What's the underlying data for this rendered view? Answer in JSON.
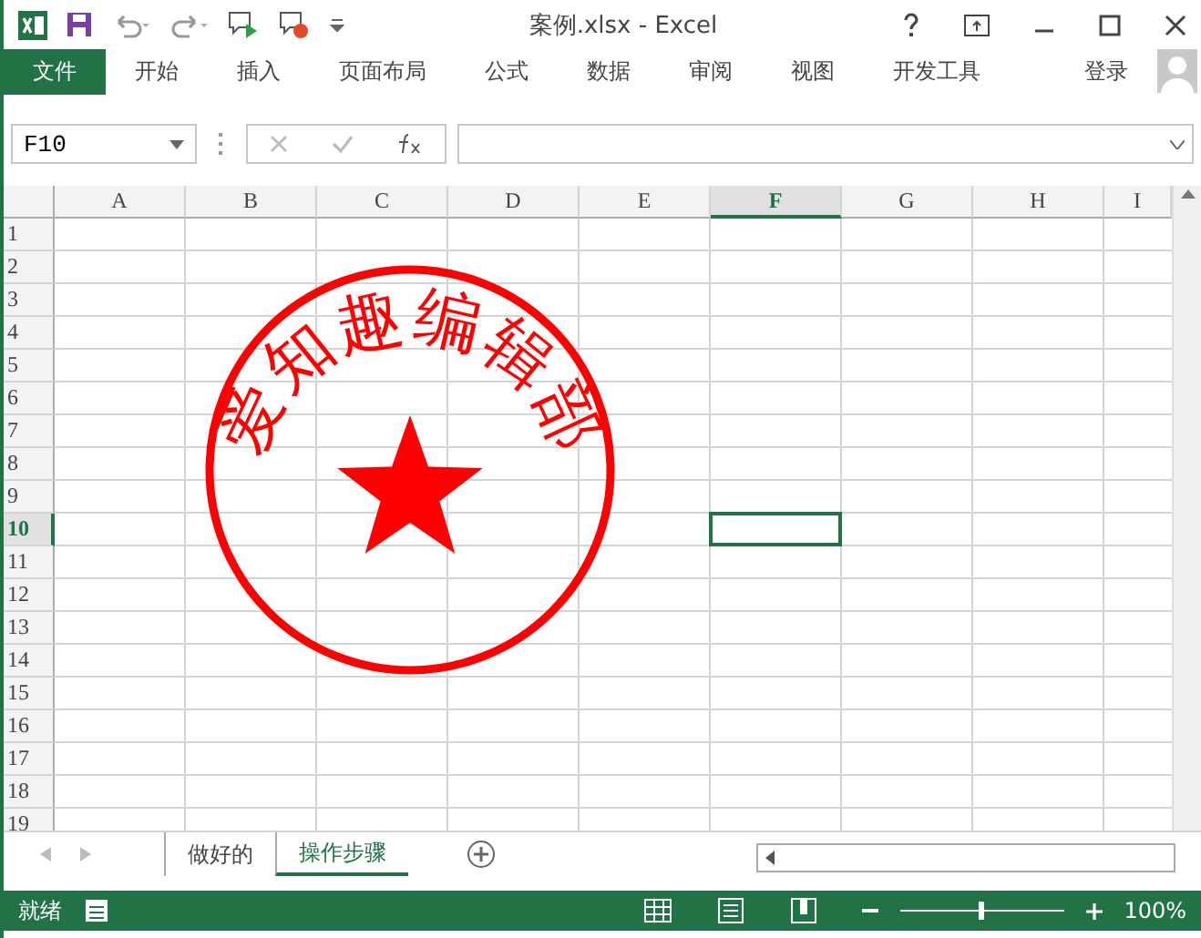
{
  "window": {
    "title": "案例.xlsx - Excel"
  },
  "ribbon_tabs": [
    {
      "label": "文件",
      "selected": true
    },
    {
      "label": "开始",
      "selected": false
    },
    {
      "label": "插入",
      "selected": false
    },
    {
      "label": "页面布局",
      "selected": false
    },
    {
      "label": "公式",
      "selected": false
    },
    {
      "label": "数据",
      "selected": false
    },
    {
      "label": "审阅",
      "selected": false
    },
    {
      "label": "视图",
      "selected": false
    },
    {
      "label": "开发工具",
      "selected": false
    }
  ],
  "sign_in": "登录",
  "name_box": "F10",
  "columns": [
    {
      "label": "A",
      "selected": false
    },
    {
      "label": "B",
      "selected": false
    },
    {
      "label": "C",
      "selected": false
    },
    {
      "label": "D",
      "selected": false
    },
    {
      "label": "E",
      "selected": false
    },
    {
      "label": "F",
      "selected": true
    },
    {
      "label": "G",
      "selected": false
    },
    {
      "label": "H",
      "selected": false
    },
    {
      "label": "I",
      "selected": false
    }
  ],
  "rows": [
    {
      "label": "1",
      "selected": false
    },
    {
      "label": "2",
      "selected": false
    },
    {
      "label": "3",
      "selected": false
    },
    {
      "label": "4",
      "selected": false
    },
    {
      "label": "5",
      "selected": false
    },
    {
      "label": "6",
      "selected": false
    },
    {
      "label": "7",
      "selected": false
    },
    {
      "label": "8",
      "selected": false
    },
    {
      "label": "9",
      "selected": false
    },
    {
      "label": "10",
      "selected": true
    },
    {
      "label": "11",
      "selected": false
    },
    {
      "label": "12",
      "selected": false
    },
    {
      "label": "13",
      "selected": false
    },
    {
      "label": "14",
      "selected": false
    },
    {
      "label": "15",
      "selected": false
    },
    {
      "label": "16",
      "selected": false
    },
    {
      "label": "17",
      "selected": false
    },
    {
      "label": "18",
      "selected": false
    },
    {
      "label": "19",
      "selected": false
    }
  ],
  "stamp": {
    "text": "爱知趣编辑部"
  },
  "sheet_tabs": [
    {
      "label": "做好的",
      "selected": false
    },
    {
      "label": "操作步骤",
      "selected": true
    }
  ],
  "status": {
    "text": "就绪",
    "zoom": "100%"
  }
}
